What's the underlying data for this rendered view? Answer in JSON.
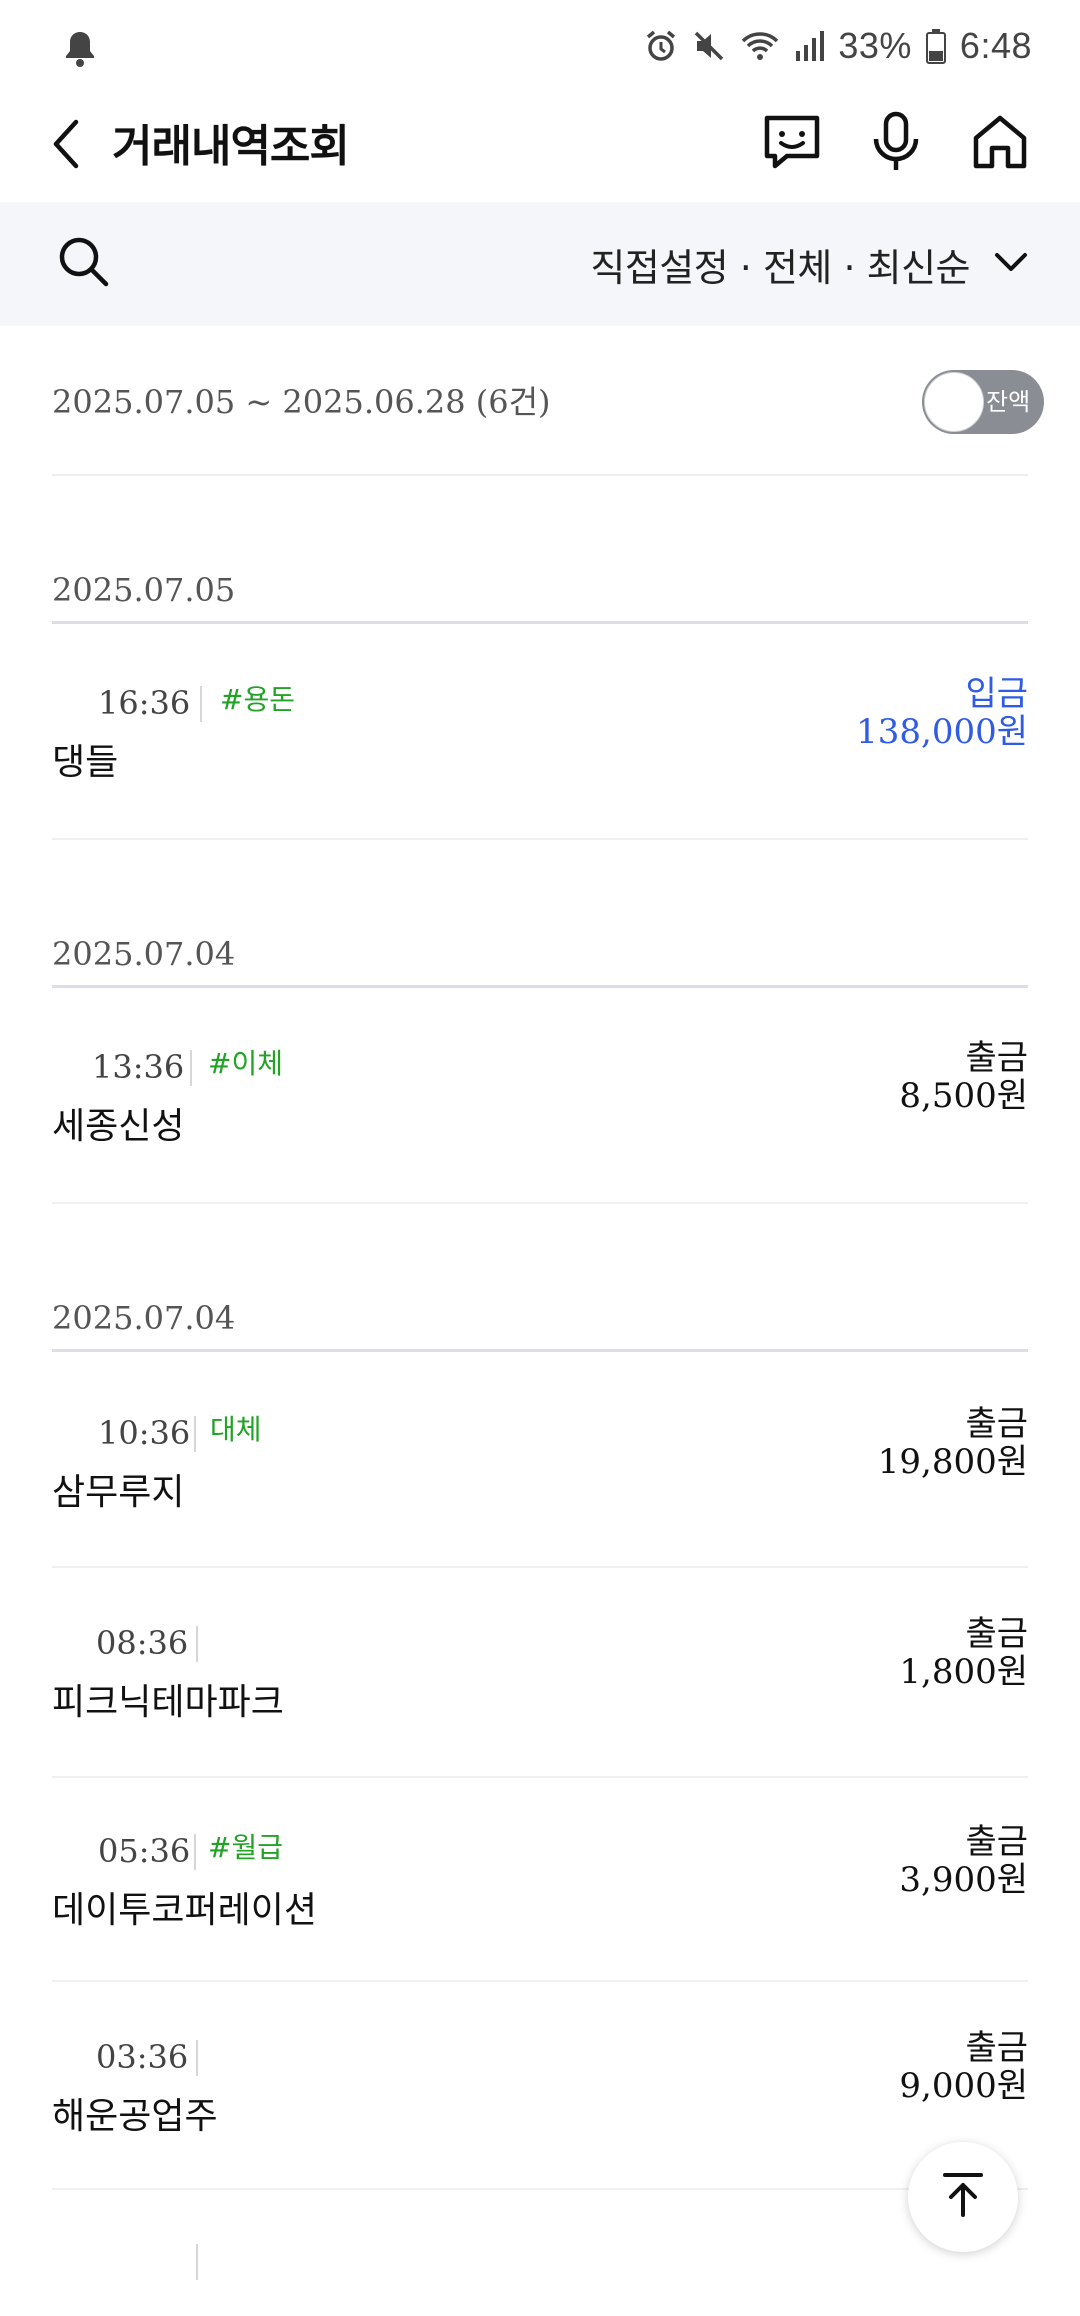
{
  "status_bar": {
    "battery": "33%",
    "time": "6:48"
  },
  "header": {
    "title": "거래내역조회"
  },
  "filter": {
    "label": "직접설정 · 전체 · 최신순"
  },
  "summary": {
    "range": "2025.07.05 ~ 2025.06.28 (6건)",
    "balance_toggle_label": "잔액",
    "balance_toggle_on": false
  },
  "groups": [
    {
      "date": "2025.07.05",
      "transactions": [
        {
          "time": "16:36",
          "tag": "#용돈",
          "name": "댕들",
          "type": "입금",
          "amount": "138,000원",
          "color": "#2f5be6"
        }
      ]
    },
    {
      "date": "2025.07.04",
      "transactions": [
        {
          "time": "13:36",
          "tag": "#이체",
          "name": "세종신성",
          "type": "출금",
          "amount": "8,500원",
          "color": "#111111"
        }
      ]
    },
    {
      "date": "2025.07.04",
      "transactions": [
        {
          "time": "10:36",
          "tag": "대체",
          "name": "삼무루지",
          "type": "출금",
          "amount": "19,800원",
          "color": "#111111"
        },
        {
          "time": "08:36",
          "tag": "",
          "name": "피크닉테마파크",
          "type": "출금",
          "amount": "1,800원",
          "color": "#111111"
        },
        {
          "time": "05:36",
          "tag": "#월급",
          "name": "데이투코퍼레이션",
          "type": "출금",
          "amount": "3,900원",
          "color": "#111111"
        },
        {
          "time": "03:36",
          "tag": "",
          "name": "해운공업주",
          "type": "출금",
          "amount": "9,000원",
          "color": "#111111"
        }
      ]
    }
  ],
  "colors": {
    "deposit": "#2f5be6",
    "tag": "#22a326",
    "filter_bg": "#f4f6fa"
  }
}
